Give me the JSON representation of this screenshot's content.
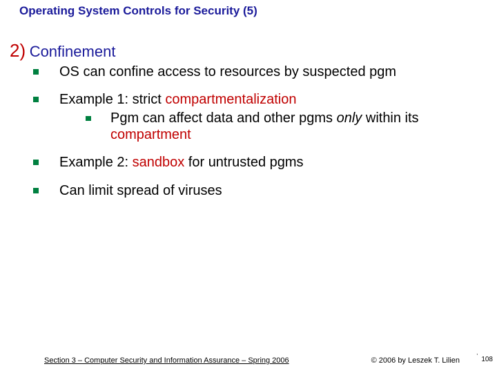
{
  "title": "Operating System Controls for Security (5)",
  "section": {
    "number": "2)",
    "heading": "Confinement",
    "bullets": [
      {
        "text_parts": [
          {
            "t": "OS can confine access to resources by suspected pgm"
          }
        ]
      },
      {
        "text_parts": [
          {
            "t": "Example 1: strict "
          },
          {
            "t": "compartmentalization",
            "cls": "red"
          }
        ],
        "sub": {
          "text_parts": [
            {
              "t": "Pgm can affect data and other pgms "
            },
            {
              "t": "only",
              "cls": "italic"
            },
            {
              "t": " within its "
            },
            {
              "t": "compartment",
              "cls": "red"
            }
          ]
        }
      },
      {
        "text_parts": [
          {
            "t": "Example 2: "
          },
          {
            "t": "sandbox",
            "cls": "red"
          },
          {
            "t": " for untrusted pgms"
          }
        ]
      },
      {
        "text_parts": [
          {
            "t": "Can limit spread of viruses"
          }
        ]
      }
    ]
  },
  "footer": {
    "left": "Section 3 – Computer Security and Information Assurance – Spring 2006",
    "right": "© 2006 by Leszek T. Lilien",
    "page": "108",
    "tick": "'"
  }
}
